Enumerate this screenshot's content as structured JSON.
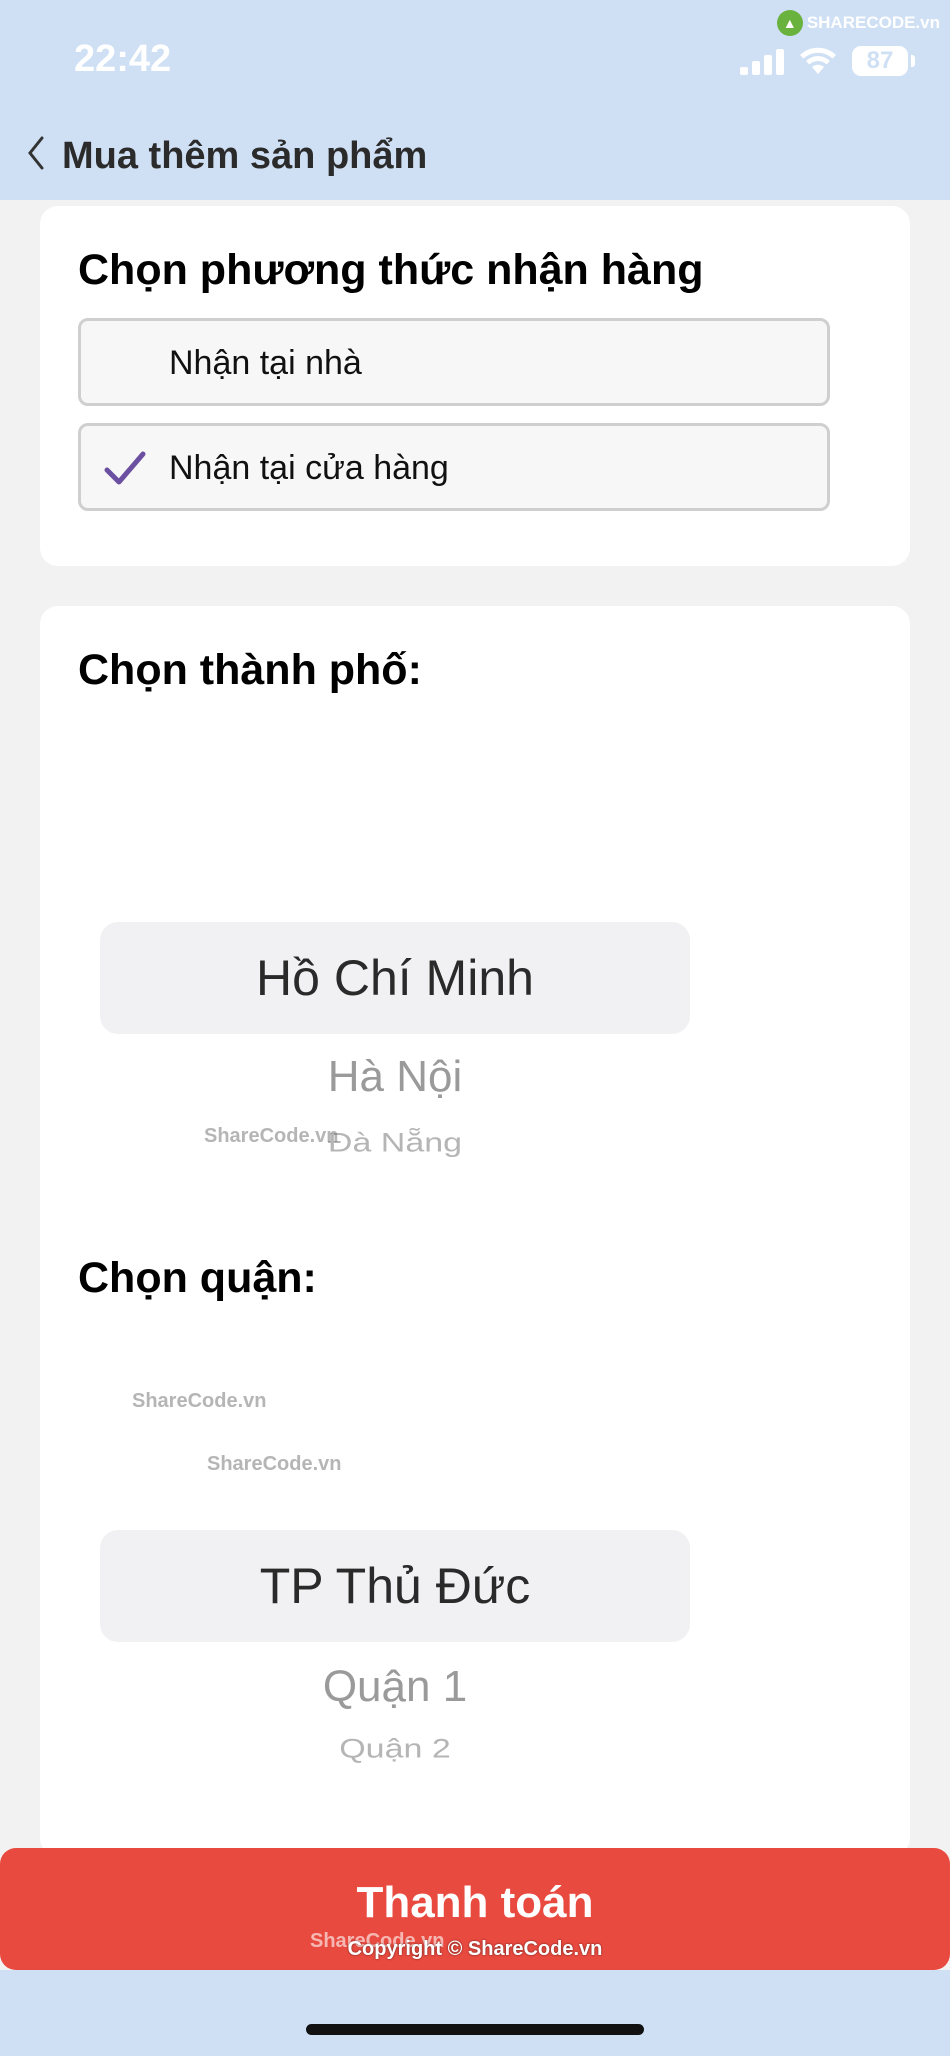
{
  "status_bar": {
    "time": "22:42",
    "battery": "87",
    "watermark_brand": "SHARECODE.vn"
  },
  "nav": {
    "title": "Mua thêm sản phẩm"
  },
  "delivery": {
    "title": "Chọn phương thức nhận hàng",
    "options": [
      {
        "label": "Nhận tại nhà",
        "selected": false
      },
      {
        "label": "Nhận tại cửa hàng",
        "selected": true
      }
    ],
    "check_color": "#6b4fa0"
  },
  "city": {
    "title": "Chọn thành phố:",
    "selected": "Hồ Chí Minh",
    "items": [
      "Hà Nội",
      "Đà Nẵng"
    ]
  },
  "district": {
    "title": "Chọn quận:",
    "selected": "TP Thủ Đức",
    "items": [
      "Quận 1",
      "Quận 2"
    ]
  },
  "payment": {
    "label": "Thanh toán",
    "color": "#e94a3f"
  },
  "watermarks": {
    "text": "ShareCode.vn",
    "copyright": "Copyright © ShareCode.vn"
  }
}
